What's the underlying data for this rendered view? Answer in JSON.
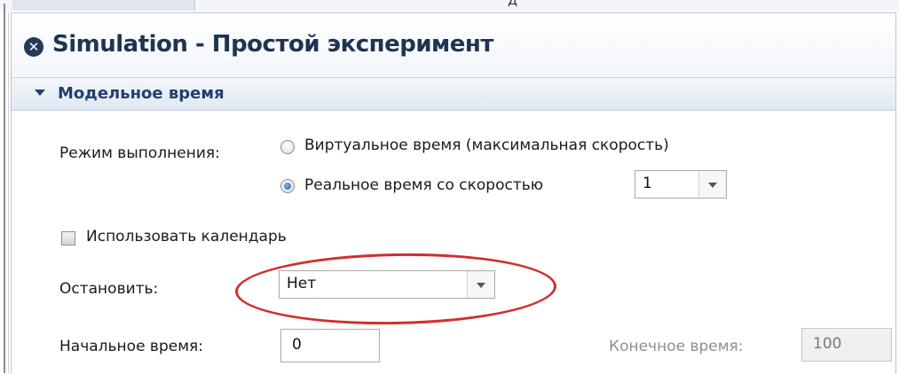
{
  "window": {
    "title": "Simulation - Простой эксперимент",
    "title_icon": "close-circle-icon"
  },
  "top_strip": {
    "cut_text": "д"
  },
  "section": {
    "label": "Модельное время",
    "expanded": true
  },
  "execution_mode": {
    "label": "Режим выполнения:",
    "options": [
      {
        "label": "Виртуальное время (максимальная скорость)",
        "checked": false
      },
      {
        "label": "Реальное время со скоростью",
        "checked": true
      }
    ],
    "speed_value": "1"
  },
  "calendar": {
    "label": "Использовать календарь",
    "checked": false
  },
  "stop": {
    "label": "Остановить:",
    "value": "Нет"
  },
  "start_time": {
    "label": "Начальное время:",
    "value": "0"
  },
  "end_time": {
    "label": "Конечное время:",
    "value": "100",
    "disabled": true
  },
  "annotation": {
    "color": "#d32d2d",
    "target": "stop-combo"
  },
  "colors": {
    "title": "#1f3352",
    "section": "#21406d",
    "radio_selected": "#1e5fb8"
  }
}
